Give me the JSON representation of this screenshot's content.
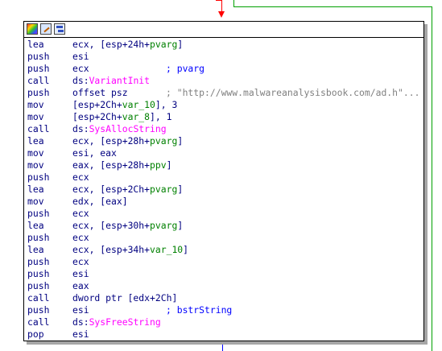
{
  "colors": {
    "instruction": "#000080",
    "api_name": "#ff00ff",
    "local_var": "#008000",
    "comment": "#0000ff",
    "string": "#808080",
    "edge_jump": "#ff0000",
    "edge_true": "#00a000",
    "edge_flow": "#0000ff"
  },
  "toolbar": {
    "icons": [
      "color-palette-icon",
      "edit-node-icon",
      "graph-overview-icon"
    ]
  },
  "lines": [
    {
      "mnem": "lea",
      "ops": [
        {
          "t": "ecx, [esp+24h+"
        },
        {
          "t": "pvarg",
          "c": "var"
        },
        {
          "t": "]"
        }
      ]
    },
    {
      "mnem": "push",
      "ops": [
        {
          "t": "esi"
        }
      ]
    },
    {
      "mnem": "push",
      "ops": [
        {
          "t": "ecx"
        }
      ],
      "comment": "; pvarg"
    },
    {
      "mnem": "call",
      "ops": [
        {
          "t": "ds:"
        },
        {
          "t": "VariantInit",
          "c": "fn"
        }
      ]
    },
    {
      "mnem": "push",
      "ops": [
        {
          "t": "offset psz"
        }
      ],
      "comment": "; \"http://www.malwareanalysisbook.com/ad.h\"...",
      "comment_str": true
    },
    {
      "mnem": "mov",
      "ops": [
        {
          "t": "[esp+2Ch+"
        },
        {
          "t": "var_10",
          "c": "var"
        },
        {
          "t": "], 3"
        }
      ]
    },
    {
      "mnem": "mov",
      "ops": [
        {
          "t": "[esp+2Ch+"
        },
        {
          "t": "var_8",
          "c": "var"
        },
        {
          "t": "], 1"
        }
      ]
    },
    {
      "mnem": "call",
      "ops": [
        {
          "t": "ds:"
        },
        {
          "t": "SysAllocString",
          "c": "fn"
        }
      ]
    },
    {
      "mnem": "lea",
      "ops": [
        {
          "t": "ecx, [esp+28h+"
        },
        {
          "t": "pvarg",
          "c": "var"
        },
        {
          "t": "]"
        }
      ]
    },
    {
      "mnem": "mov",
      "ops": [
        {
          "t": "esi, eax"
        }
      ]
    },
    {
      "mnem": "mov",
      "ops": [
        {
          "t": "eax, [esp+28h+"
        },
        {
          "t": "ppv",
          "c": "var"
        },
        {
          "t": "]"
        }
      ]
    },
    {
      "mnem": "push",
      "ops": [
        {
          "t": "ecx"
        }
      ]
    },
    {
      "mnem": "lea",
      "ops": [
        {
          "t": "ecx, [esp+2Ch+"
        },
        {
          "t": "pvarg",
          "c": "var"
        },
        {
          "t": "]"
        }
      ]
    },
    {
      "mnem": "mov",
      "ops": [
        {
          "t": "edx, [eax]"
        }
      ]
    },
    {
      "mnem": "push",
      "ops": [
        {
          "t": "ecx"
        }
      ]
    },
    {
      "mnem": "lea",
      "ops": [
        {
          "t": "ecx, [esp+30h+"
        },
        {
          "t": "pvarg",
          "c": "var"
        },
        {
          "t": "]"
        }
      ]
    },
    {
      "mnem": "push",
      "ops": [
        {
          "t": "ecx"
        }
      ]
    },
    {
      "mnem": "lea",
      "ops": [
        {
          "t": "ecx, [esp+34h+"
        },
        {
          "t": "var_10",
          "c": "var"
        },
        {
          "t": "]"
        }
      ]
    },
    {
      "mnem": "push",
      "ops": [
        {
          "t": "ecx"
        }
      ]
    },
    {
      "mnem": "push",
      "ops": [
        {
          "t": "esi"
        }
      ]
    },
    {
      "mnem": "push",
      "ops": [
        {
          "t": "eax"
        }
      ]
    },
    {
      "mnem": "call",
      "ops": [
        {
          "t": "dword ptr [edx+2Ch]"
        }
      ]
    },
    {
      "mnem": "push",
      "ops": [
        {
          "t": "esi"
        }
      ],
      "comment": "; bstrString"
    },
    {
      "mnem": "call",
      "ops": [
        {
          "t": "ds:"
        },
        {
          "t": "SysFreeString",
          "c": "fn"
        }
      ]
    },
    {
      "mnem": "pop",
      "ops": [
        {
          "t": "esi"
        }
      ]
    }
  ]
}
